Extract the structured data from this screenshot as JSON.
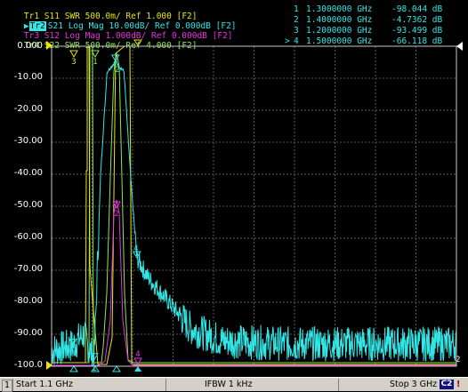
{
  "traces": [
    {
      "id": "Tr1",
      "param": "S11",
      "format": "SWR",
      "scale": "500.0m/",
      "ref": "Ref 1.000",
      "channel": "[F2]",
      "color": "#e6e610",
      "active": false
    },
    {
      "id": "Tr2",
      "param": "S21",
      "format": "Log Mag",
      "scale": "10.00dB/",
      "ref": "Ref 0.000dB",
      "channel": "[F2]",
      "color": "#33e6e6",
      "active": true
    },
    {
      "id": "Tr3",
      "param": "S12",
      "format": "Log Mag",
      "scale": "1.000dB/",
      "ref": "Ref 0.000dB",
      "channel": "[F2]",
      "color": "#e633e6",
      "active": false
    },
    {
      "id": "Tr4",
      "param": "S22",
      "format": "SWR",
      "scale": "500.0m/",
      "ref": "Ref 4.000",
      "channel": "[F2]",
      "color": "#90e650",
      "active": false
    }
  ],
  "markers": [
    {
      "active": "",
      "index": "1",
      "freq": "1.3000000 GHz",
      "value": "-98.044 dB"
    },
    {
      "active": "",
      "index": "2",
      "freq": "1.4000000 GHz",
      "value": "-4.7362 dB"
    },
    {
      "active": "",
      "index": "3",
      "freq": "1.2000000 GHz",
      "value": "-93.499 dB"
    },
    {
      "active": ">",
      "index": "4",
      "freq": "1.5000000 GHz",
      "value": "-66.118 dB"
    }
  ],
  "y_axis": {
    "labels": [
      "0.000",
      "-10.00",
      "-20.00",
      "-30.00",
      "-40.00",
      "-50.00",
      "-60.00",
      "-70.00",
      "-80.00",
      "-90.00",
      "-100.0"
    ],
    "ref_marker_right": "2"
  },
  "chart_data": {
    "type": "line",
    "x": {
      "start_ghz": 1.1,
      "stop_ghz": 3.0
    },
    "ylim": [
      -100,
      0
    ],
    "active_series": "S21",
    "series": [
      {
        "name": "S21",
        "points_ghz_db": [
          [
            1.1,
            -95
          ],
          [
            1.2,
            -93.5
          ],
          [
            1.25,
            -90
          ],
          [
            1.3,
            -98
          ],
          [
            1.33,
            -40
          ],
          [
            1.36,
            -8
          ],
          [
            1.4,
            -4.7
          ],
          [
            1.44,
            -8
          ],
          [
            1.47,
            -40
          ],
          [
            1.5,
            -66.1
          ],
          [
            1.55,
            -72
          ],
          [
            1.65,
            -80
          ],
          [
            1.75,
            -88
          ],
          [
            1.9,
            -92
          ],
          [
            2.2,
            -93
          ],
          [
            2.6,
            -93
          ],
          [
            3.0,
            -93
          ]
        ]
      }
    ],
    "marker_labels": [
      "1",
      "2",
      "3",
      "4"
    ]
  },
  "status": {
    "channel_num": "1",
    "start": "Start 1.1 GHz",
    "ifbw": "IFBW 1 kHz",
    "stop": "Stop 3 GHz",
    "cal_badge": "C2",
    "warning": "!"
  },
  "colors": {
    "tr1": "#e6e610",
    "tr2": "#33e6e6",
    "tr3": "#e633e6",
    "tr4": "#90e650",
    "grid": "#5a5a5a",
    "plot_border": "#c8c8c8"
  }
}
